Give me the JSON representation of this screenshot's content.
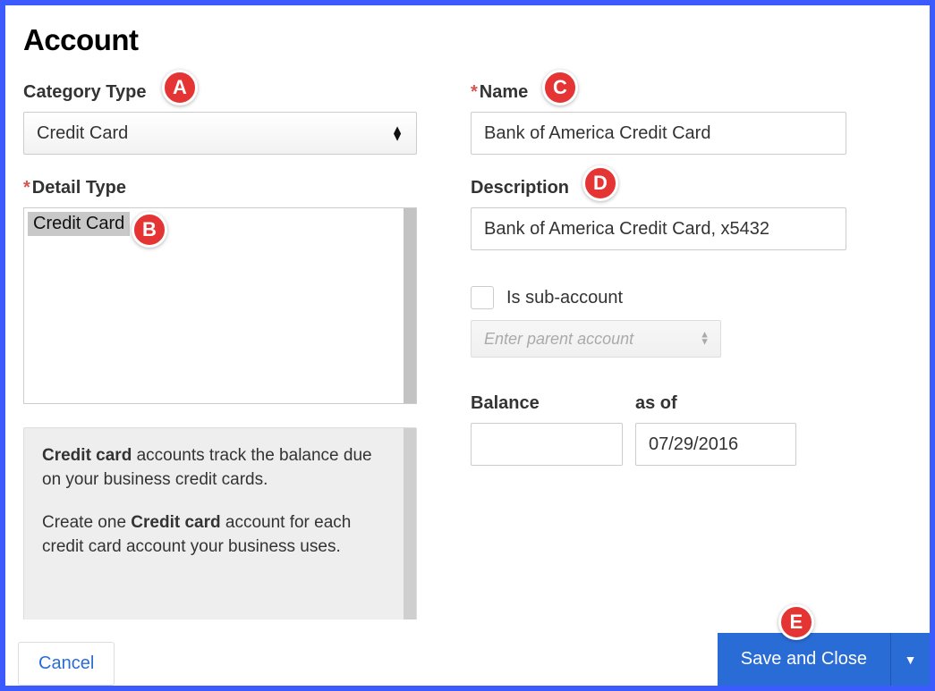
{
  "title": "Account",
  "left": {
    "category_label": "Category Type",
    "category_value": "Credit Card",
    "detail_label": "Detail Type",
    "detail_items": [
      "Credit Card"
    ],
    "hint_bold1": "Credit card",
    "hint_text1": " accounts track the balance due on your business credit cards.",
    "hint_text2a": "Create one ",
    "hint_bold2": "Credit card",
    "hint_text2b": " account for each credit card account your business uses."
  },
  "right": {
    "name_label": "Name",
    "name_value": "Bank of America Credit Card",
    "desc_label": "Description",
    "desc_value": "Bank of America Credit Card, x5432",
    "sub_label": "Is sub-account",
    "parent_placeholder": "Enter parent account",
    "balance_label": "Balance",
    "asof_label": "as of",
    "balance_value": "",
    "asof_value": "07/29/2016"
  },
  "footer": {
    "cancel": "Cancel",
    "save": "Save and Close"
  },
  "badges": {
    "A": "A",
    "B": "B",
    "C": "C",
    "D": "D",
    "E": "E"
  }
}
